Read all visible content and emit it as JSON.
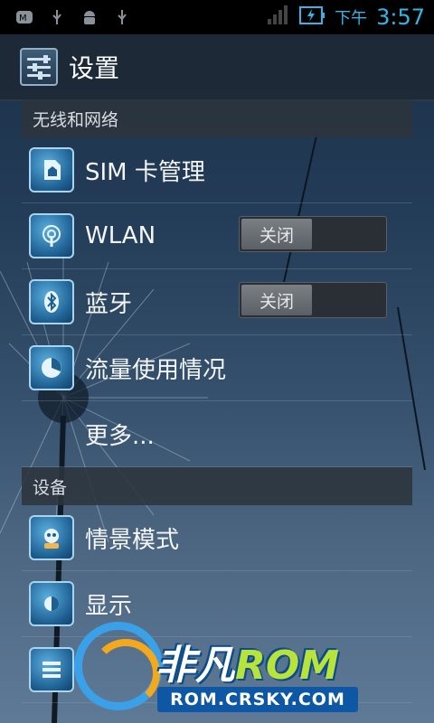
{
  "status_bar": {
    "ampm": "下午",
    "time": "3:57",
    "icons": [
      "app-m-icon",
      "usb-icon",
      "android-debug-icon",
      "usb-icon",
      "signal-icon",
      "battery-charging-icon"
    ]
  },
  "action_bar": {
    "title": "设置",
    "icon": "settings-sliders-icon"
  },
  "sections": {
    "wireless": {
      "header": "无线和网络",
      "items": [
        {
          "label": "SIM 卡管理",
          "icon": "sim-card-icon"
        },
        {
          "label": "WLAN",
          "icon": "wifi-icon",
          "toggle": "关闭"
        },
        {
          "label": "蓝牙",
          "icon": "bluetooth-icon",
          "toggle": "关闭"
        },
        {
          "label": "流量使用情况",
          "icon": "data-usage-icon"
        },
        {
          "label": "更多...",
          "icon": ""
        }
      ]
    },
    "device": {
      "header": "设备",
      "items": [
        {
          "label": "情景模式",
          "icon": "profile-icon"
        },
        {
          "label": "显示",
          "icon": "display-brightness-icon"
        },
        {
          "label": "",
          "icon": "storage-icon"
        }
      ]
    }
  },
  "watermark": {
    "brand": "非凡",
    "brand_rom": "ROM",
    "url": "ROM.CRSKY.COM"
  },
  "colors": {
    "accent": "#33b5e5",
    "icon_blue": "#1e5f91",
    "watermark_green": "#b8e33a"
  }
}
